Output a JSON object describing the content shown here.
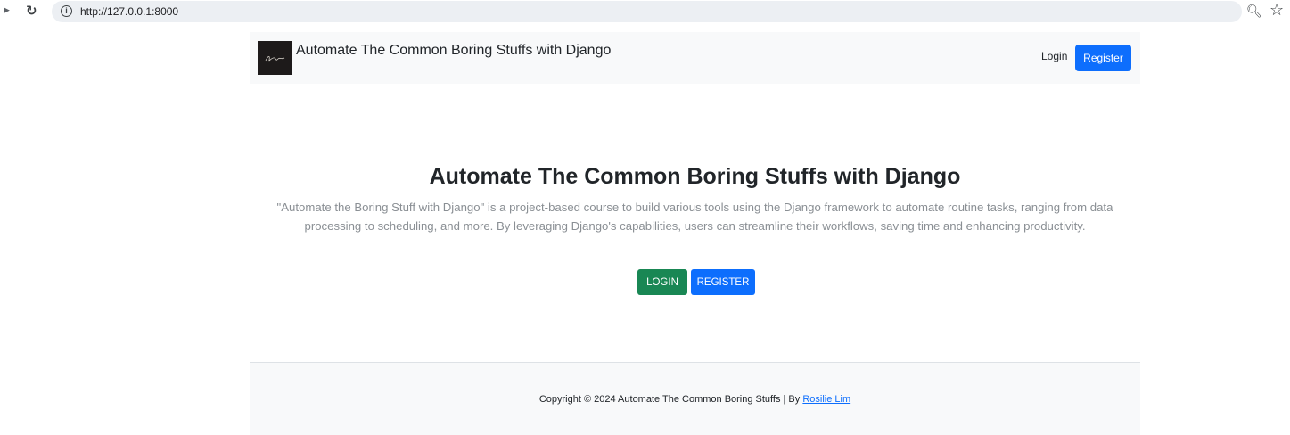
{
  "browser": {
    "url": "http://127.0.0.1:8000"
  },
  "navbar": {
    "brand_title": "Automate The Common Boring Stuffs with Django",
    "login_label": "Login",
    "register_label": "Register"
  },
  "hero": {
    "title": "Automate The Common Boring Stuffs with Django",
    "description": "\"Automate the Boring Stuff with Django\" is a project-based course to build various tools using the Django framework to automate routine tasks, ranging from data processing to scheduling, and more. By leveraging Django's capabilities, users can streamline their workflows, saving time and enhancing productivity.",
    "login_button": "LOGIN",
    "register_button": "REGISTER"
  },
  "footer": {
    "copyright": "Copyright © 2024 Automate The Common Boring Stuffs | By ",
    "author": "Rosilie Lim"
  },
  "colors": {
    "primary": "#0d6efd",
    "success": "#198754",
    "light_bg": "#f8f9fa",
    "muted_text": "#8a8f94"
  }
}
